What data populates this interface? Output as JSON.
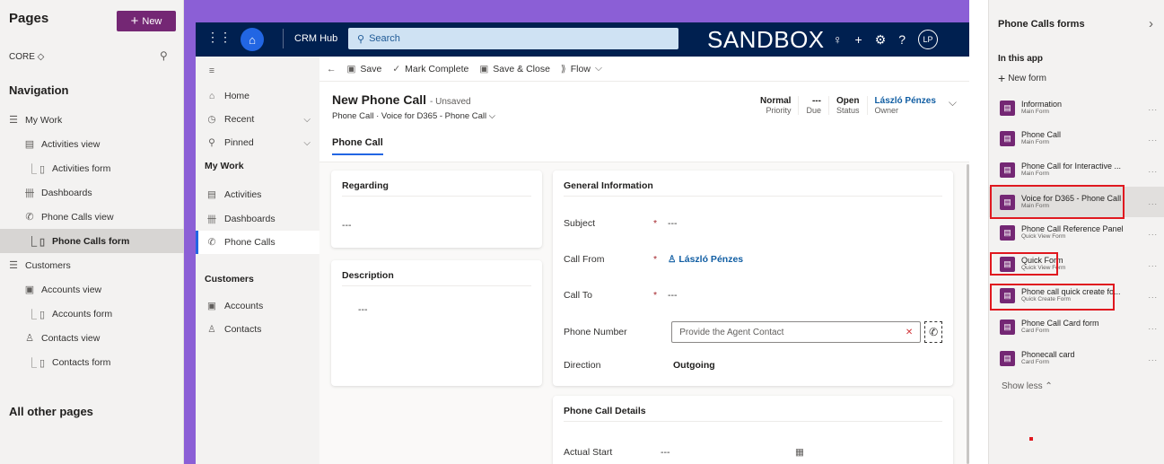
{
  "left_panel": {
    "title": "Pages",
    "new_button": "New",
    "new_plus": "+",
    "solution": "CORE ◇",
    "navigation_header": "Navigation",
    "items": [
      {
        "label": "My Work",
        "icon": "list-icon",
        "glyph": "☰",
        "indent": 0
      },
      {
        "label": "Activities view",
        "icon": "clipboard-icon",
        "glyph": "▤",
        "indent": 1
      },
      {
        "label": "Activities form",
        "icon": "form-icon",
        "glyph": "⎿ ▯",
        "indent": 1
      },
      {
        "label": "Dashboards",
        "icon": "dashboard-icon",
        "glyph": "卌",
        "indent": 1
      },
      {
        "label": "Phone Calls view",
        "icon": "phone-icon",
        "glyph": "✆",
        "indent": 1
      },
      {
        "label": "Phone Calls form",
        "icon": "form-icon",
        "glyph": "⎿ ▯",
        "indent": 1,
        "selected": true
      },
      {
        "label": "Customers",
        "icon": "list-icon",
        "glyph": "☰",
        "indent": 0
      },
      {
        "label": "Accounts view",
        "icon": "building-icon",
        "glyph": "▣",
        "indent": 1
      },
      {
        "label": "Accounts form",
        "icon": "form-icon",
        "glyph": "⎿ ▯",
        "indent": 1
      },
      {
        "label": "Contacts view",
        "icon": "person-icon",
        "glyph": "♙",
        "indent": 1
      },
      {
        "label": "Contacts form",
        "icon": "form-icon",
        "glyph": "⎿ ▯",
        "indent": 1
      }
    ],
    "all_other_pages": "All other pages"
  },
  "app_header": {
    "app_name": "CRM Hub",
    "search_placeholder": "Search",
    "environment": "SANDBOX",
    "initials": "LP"
  },
  "inner_nav": {
    "home": "Home",
    "recent": "Recent",
    "pinned": "Pinned",
    "my_work_group": "My Work",
    "activities": "Activities",
    "dashboards": "Dashboards",
    "phone_calls": "Phone Calls",
    "customers_group": "Customers",
    "accounts": "Accounts",
    "contacts": "Contacts"
  },
  "command_bar": {
    "save": "Save",
    "mark_complete": "Mark Complete",
    "save_close": "Save & Close",
    "flow": "Flow"
  },
  "form_header": {
    "title": "New Phone Call",
    "unsaved": "- Unsaved",
    "subtitle": "Phone Call  ·  Voice for D365 - Phone Call ⌵",
    "priority_value": "Normal",
    "priority_label": "Priority",
    "due_value": "---",
    "due_label": "Due",
    "status_value": "Open",
    "status_label": "Status",
    "owner_value": "László Pénzes",
    "owner_label": "Owner",
    "tab": "Phone Call"
  },
  "regarding_card": {
    "title": "Regarding",
    "value": "---"
  },
  "description_card": {
    "title": "Description",
    "value": "---"
  },
  "general_card": {
    "title": "General Information",
    "subject_label": "Subject",
    "subject_value": "---",
    "call_from_label": "Call From",
    "call_from_value": "László Pénzes",
    "call_to_label": "Call To",
    "call_to_value": "---",
    "phone_label": "Phone Number",
    "phone_placeholder": "Provide the Agent Contact",
    "direction_label": "Direction",
    "direction_value": "Outgoing",
    "required_mark": "*"
  },
  "details_card": {
    "title": "Phone Call Details",
    "actual_start_label": "Actual Start",
    "actual_start_value": "---"
  },
  "right_panel": {
    "title": "Phone Calls forms",
    "in_this_app": "In this app",
    "new_form": "New form",
    "forms": [
      {
        "name": "Information",
        "type": "Main Form"
      },
      {
        "name": "Phone Call",
        "type": "Main Form"
      },
      {
        "name": "Phone Call for Interactive ...",
        "type": "Main Form"
      },
      {
        "name": "Voice for D365 - Phone Call",
        "type": "Main Form",
        "selected": true
      },
      {
        "name": "Phone Call Reference Panel",
        "type": "Quick View Form"
      },
      {
        "name": "Quick Form",
        "type": "Quick View Form"
      },
      {
        "name": "Phone call quick create fo...",
        "type": "Quick Create Form"
      },
      {
        "name": "Phone Call Card form",
        "type": "Card Form"
      },
      {
        "name": "Phonecall card",
        "type": "Card Form"
      }
    ],
    "more": "...",
    "show_less": "Show less ⌃"
  },
  "colors": {
    "accent_purple": "#742774",
    "frame_purple": "#8b5fd6",
    "header_navy": "#002050",
    "highlight_red": "#e0181f",
    "link_blue": "#115ea3"
  }
}
